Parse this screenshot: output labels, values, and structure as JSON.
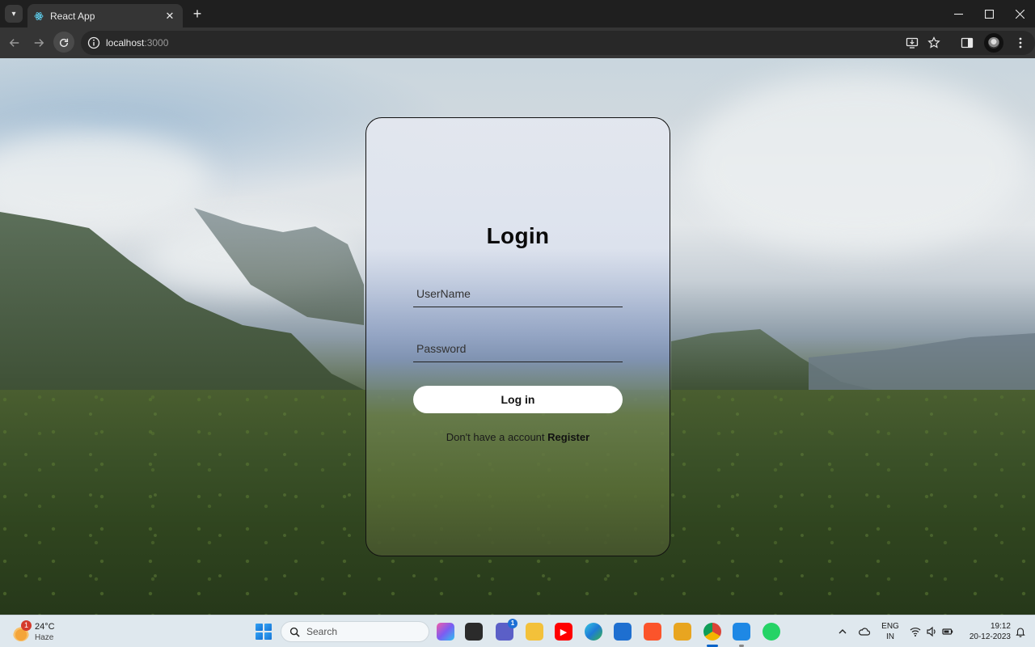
{
  "browser": {
    "tab_title": "React App",
    "url_host": "localhost",
    "url_port": ":3000"
  },
  "login": {
    "title": "Login",
    "username_placeholder": "UserName",
    "password_placeholder": "Password",
    "submit_label": "Log in",
    "register_prompt": "Don't have a account",
    "register_link": "Register"
  },
  "taskbar": {
    "weather_temp": "24°C",
    "weather_desc": "Haze",
    "weather_badge": "1",
    "search_placeholder": "Search",
    "teams_badge": "1",
    "lang_line1": "ENG",
    "lang_line2": "IN",
    "time": "19:12",
    "date": "20-12-2023"
  },
  "colors": {
    "chrome_dark": "#1f1f1f",
    "chrome_toolbar": "#353535",
    "taskbar": "#dfe8ee",
    "button_white": "#ffffff"
  }
}
